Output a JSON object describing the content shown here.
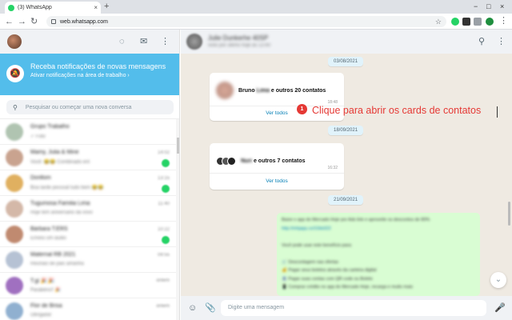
{
  "browser": {
    "tab_title": "(3) WhatsApp",
    "tab_close": "×",
    "new_tab": "+",
    "window_controls": [
      "−",
      "□",
      "×"
    ],
    "url": "web.whatsapp.com",
    "nav_icons": [
      "back-icon",
      "forward-icon",
      "reload-icon"
    ],
    "extension_colors": [
      "#25d366",
      "#333333",
      "#9aa0a6",
      "#1e8e3e"
    ]
  },
  "sidebar": {
    "notification": {
      "title": "Receba notificações de novas mensagens",
      "subtitle": "Ativar notificações na área de trabalho ›"
    },
    "search_placeholder": "Pesquisar ou começar uma nova conversa",
    "chats": [
      {
        "name": "Grupo Trabalho",
        "message": "✓ Foto",
        "time": "",
        "badge": false,
        "color": "#b0c4b1"
      },
      {
        "name": "Mamy, Julia & Mine",
        "message": "Você: 😂😂 Combinado ent",
        "time": "14:02",
        "badge": true,
        "color": "#c9a38f"
      },
      {
        "name": "Dorillom",
        "message": "Boa tarde pessoal tudo bem 😂😂",
        "time": "13:15",
        "badge": true,
        "color": "#e0b060"
      },
      {
        "name": "Tugumosa Familia Lima",
        "message": "Hoje tem aniversario da vovo",
        "time": "11:40",
        "badge": false,
        "color": "#d4b8a8"
      },
      {
        "name": "Bárbara T.ERS",
        "message": "Enviou um áudio",
        "time": "10:22",
        "badge": true,
        "color": "#c08a70"
      },
      {
        "name": "Maternal RB 2021",
        "message": "Reunião de pais amanhã",
        "time": "09:55",
        "badge": false,
        "color": "#b6c2d4"
      },
      {
        "name": "T.gi 🎉🎉",
        "message": "Parabéns!! 🎉",
        "time": "ontem",
        "badge": false,
        "color": "#a070c0"
      },
      {
        "name": "Flor de Brisa",
        "message": "Obrigada!",
        "time": "ontem",
        "badge": false,
        "color": "#90b0d0"
      }
    ]
  },
  "conversation": {
    "header_name": "Julie Dunkerhe 40SP",
    "header_sub": "visto por último hoje às 13:40",
    "dates": [
      "03/08/2021",
      "18/09/2021",
      "21/09/2021"
    ],
    "card1": {
      "title_prefix": "Bruno",
      "title_blur": "Lima",
      "title_suffix": "e outros 20 contatos",
      "time": "18:48",
      "link": "Ver todos"
    },
    "card2": {
      "title_blur": "Nuri",
      "title_suffix": "e outros 7 contatos",
      "time": "16:32",
      "link": "Ver todos"
    },
    "annotation": {
      "number": "1",
      "text": "Clique para abrir os cards de contatos",
      "color": "#e53935"
    },
    "green_message_lines": [
      "Baixe o app do Mercado Hoje por Ads link e aproveite os descontos de 80%",
      "http://mhjapp.co/10ds022",
      "",
      "Você pode usar este benefício para:",
      "",
      "🛒 Descontagem nas ofertas",
      "💰 Pagar seus boletos através da carteira digital",
      "🏦 Pagar suas contas com QR code ou Boleto",
      "📱 Comprar crédito no app do Mercado Hoje, recarga e muito mais"
    ],
    "composer_placeholder": "Digite uma mensagem"
  }
}
